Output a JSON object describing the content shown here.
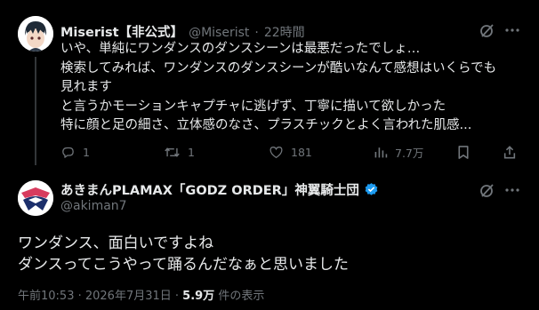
{
  "reply_tweet": {
    "author_name": "Miserist【非公式】",
    "handle": "@Miserist",
    "separator": "·",
    "time": "22時間",
    "lines": [
      "いや、単純にワンダンスのダンスシーンは最悪だったでしょ…",
      "検索してみれば、ワンダンスのダンスシーンが酷いなんて感想はいくらでも",
      "見れます",
      "と言うかモーションキャプチャに逃げず、丁寧に描いて欲しかった",
      "特に顔と足の細さ、立体感のなさ、プラスチックとよく言われた肌感..."
    ],
    "stats": {
      "replies": "1",
      "reposts": "1",
      "likes": "181",
      "views": "7.7万"
    }
  },
  "main_tweet": {
    "author_name": "あきまんPLAMAX「GODZ ORDER」神翼騎士団",
    "handle": "@akiman7",
    "lines": [
      "ワンダンス、面白いですよね",
      "ダンスってこうやって踊るんだなぁと思いました"
    ],
    "timestamp": "午前10:53 · 2026年7月31日 · ",
    "view_count": "5.9万",
    "view_suffix": " 件の表示"
  },
  "colors": {
    "background": "#000000",
    "text": "#e7e9ea",
    "muted": "#71767b",
    "verified": "#1d9bf0",
    "border": "#2f3336"
  }
}
